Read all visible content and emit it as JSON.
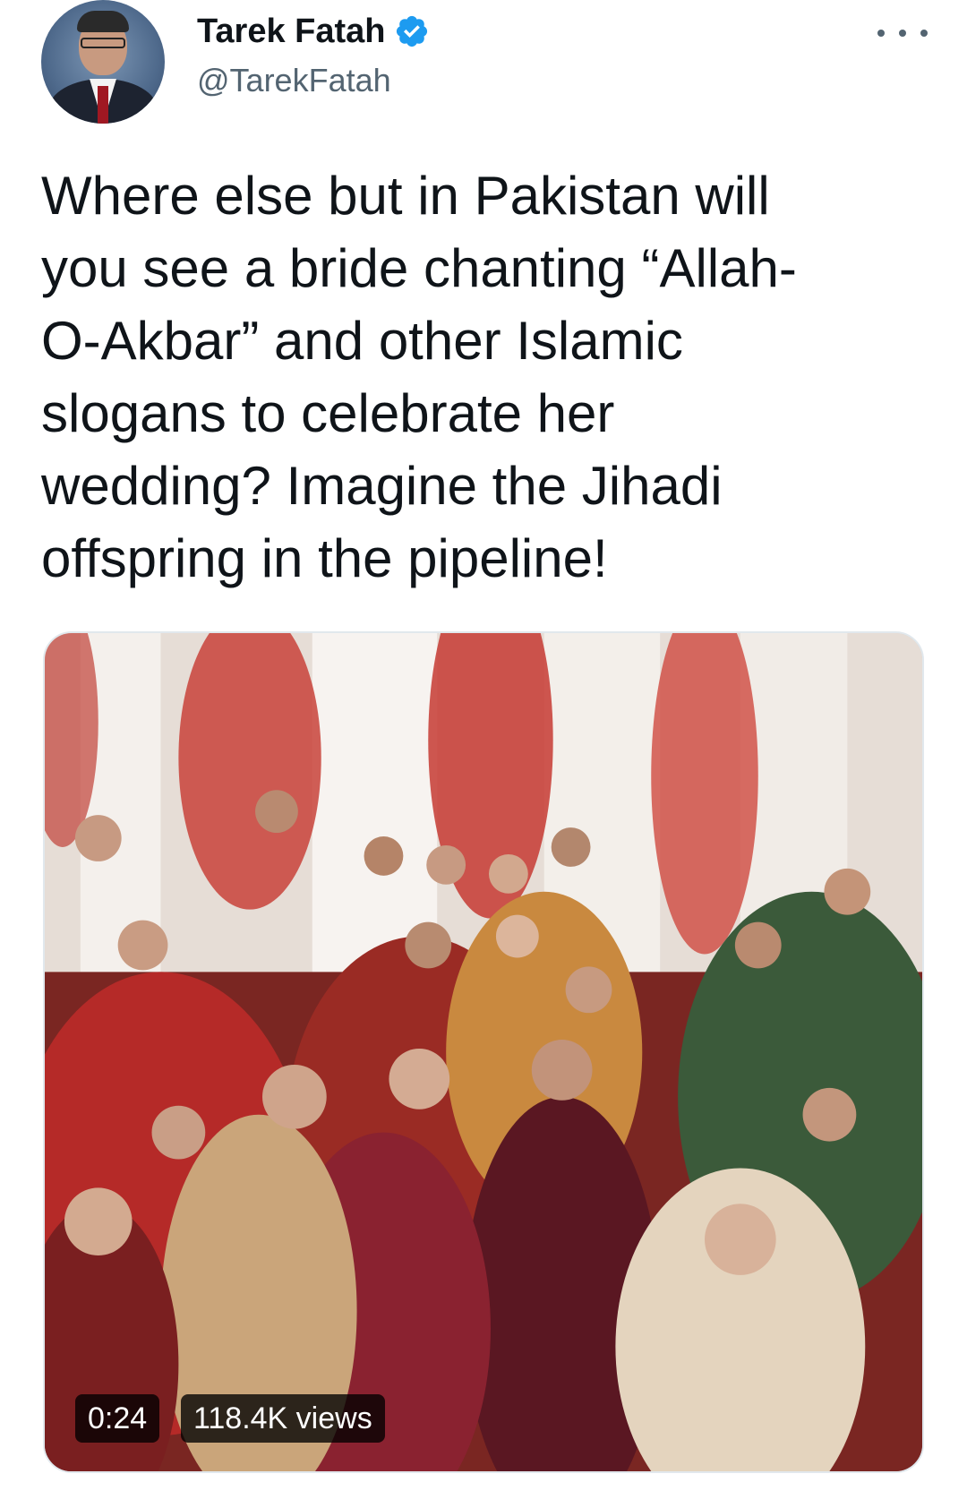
{
  "tweet": {
    "author": {
      "display_name": "Tarek Fatah",
      "handle": "@TarekFatah",
      "verified": true
    },
    "text": "Where else but in Pakistan will\nyou see a bride chanting “Allah-\nO-Akbar” and other Islamic\nslogans to celebrate her\nwedding? Imagine the Jihadi\noffspring in the pipeline!",
    "media": {
      "type": "video",
      "duration": "0:24",
      "views": "118.4K views"
    }
  },
  "icons": {
    "more": "more-horizontal-icon",
    "verified": "verified-badge-icon"
  },
  "colors": {
    "verified_blue": "#1d9bf0",
    "text_primary": "#0f1419",
    "text_secondary": "#536471"
  }
}
